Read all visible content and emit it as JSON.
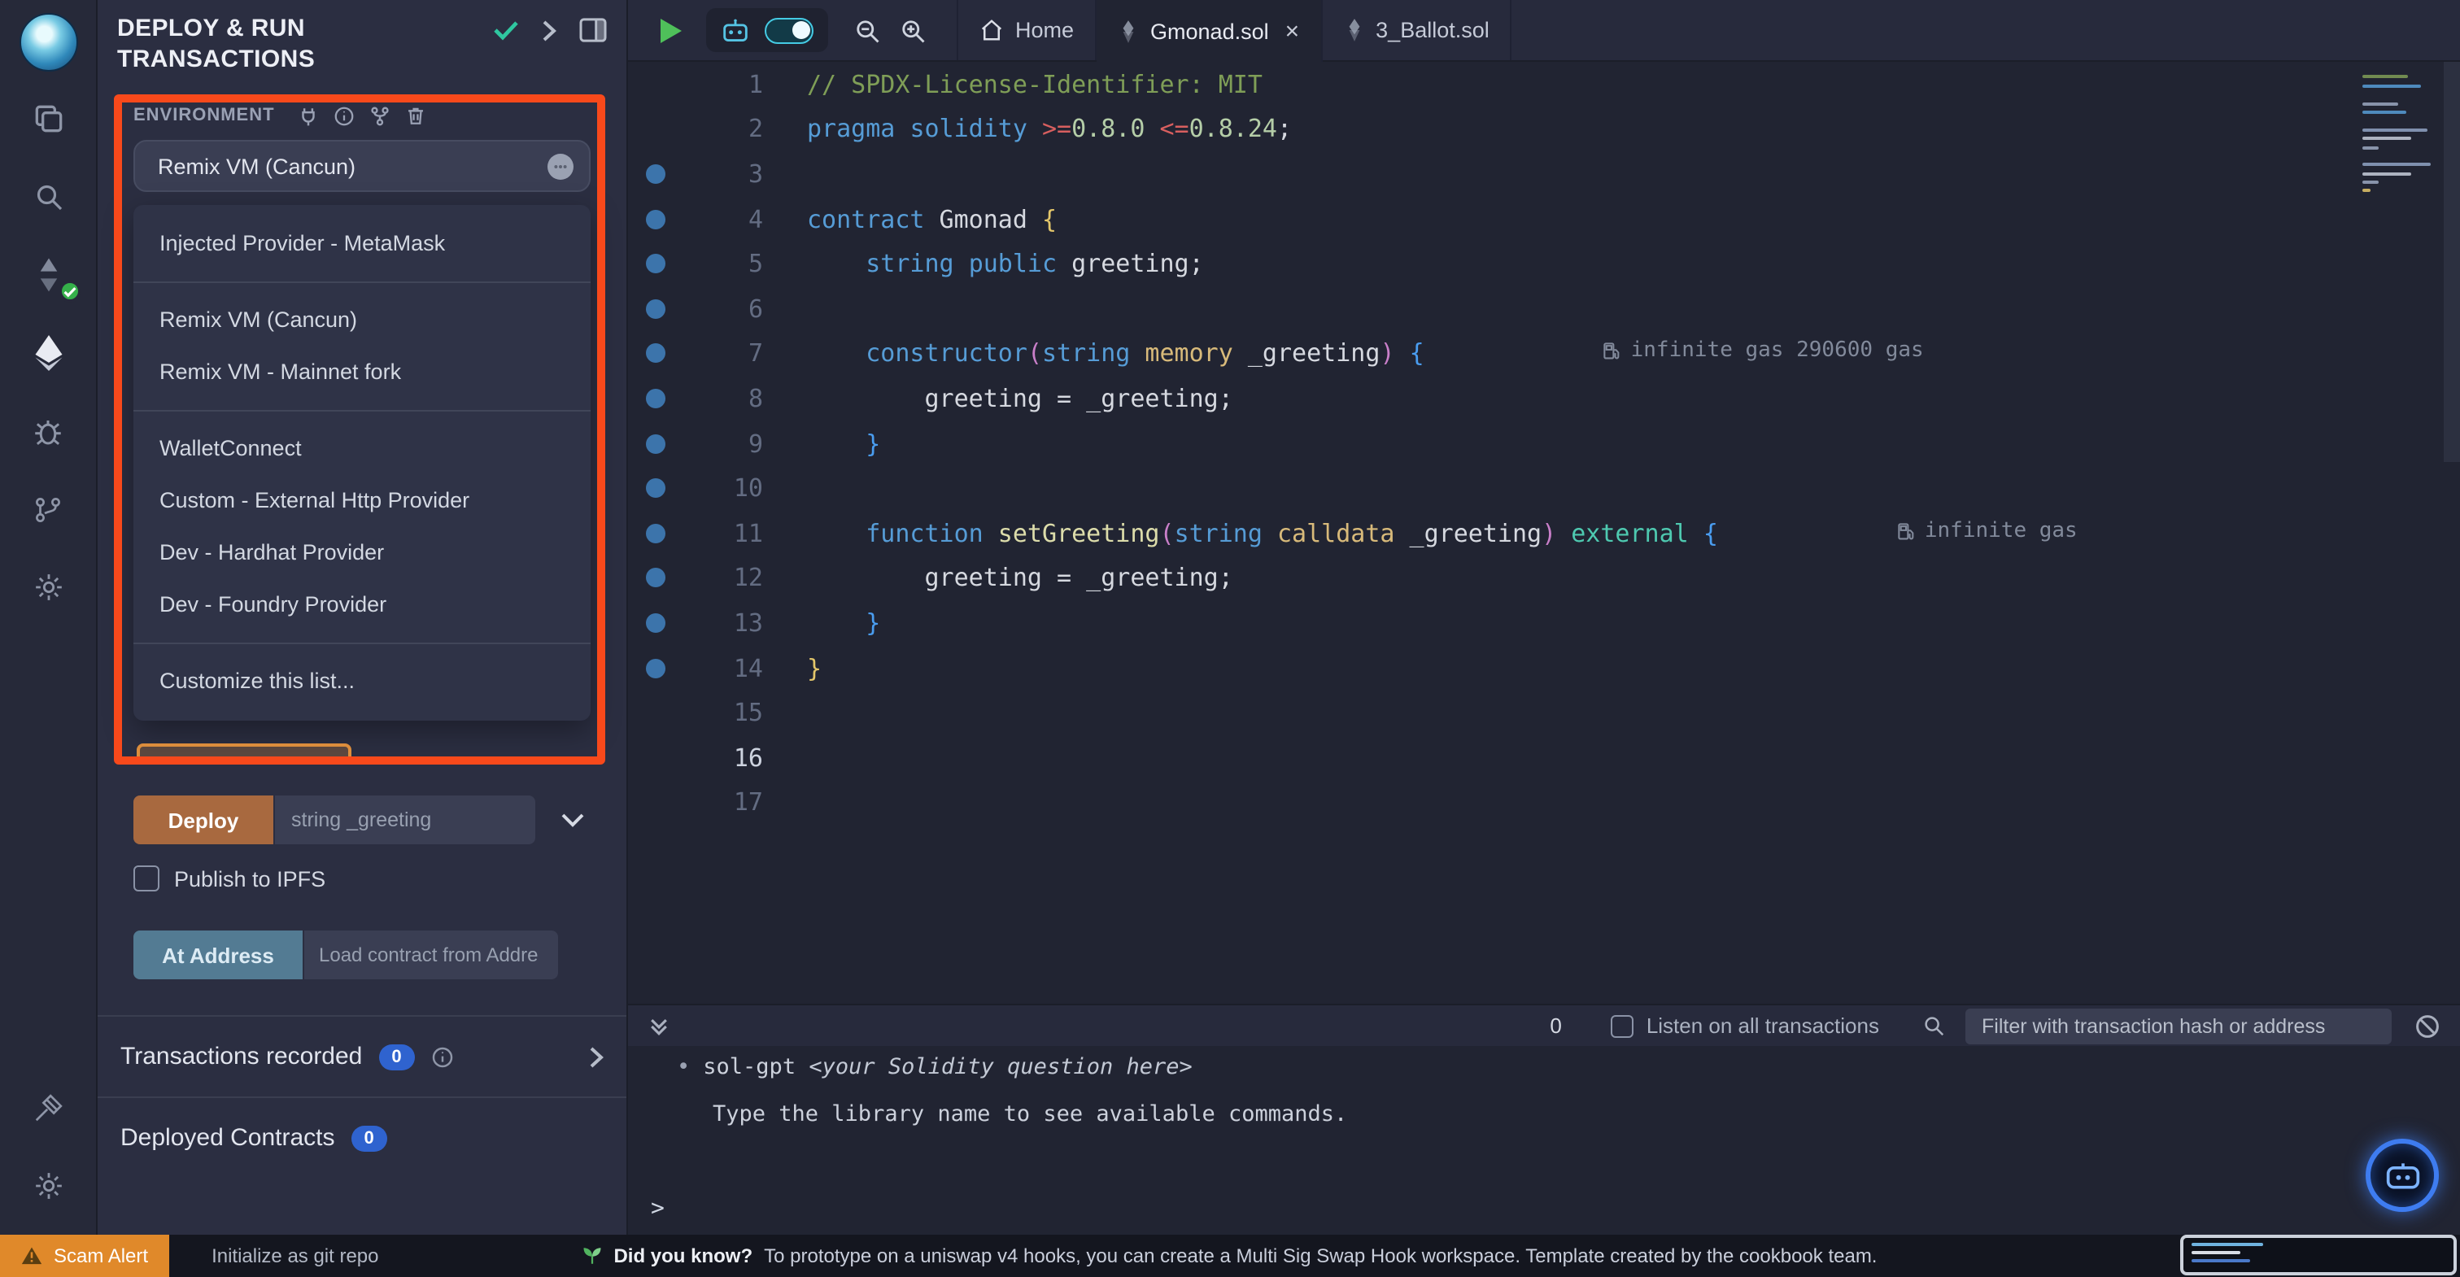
{
  "colors": {
    "highlight_box": "#f8491b",
    "deploy_button": "#a8693f",
    "at_address_button": "#537b93",
    "count_badge": "#2f63cf",
    "scam_alert_bg": "#e0892a",
    "toggle_accent": "#45cbe4",
    "run_button_green": "#4fc05a",
    "breakpoint_dot": "#3c74ab"
  },
  "rail": {
    "icons": [
      "remix-logo",
      "file-explorer",
      "search",
      "solidity-compiler",
      "deploy-and-run",
      "debugger",
      "git",
      "plugin-manager",
      "tools",
      "settings"
    ],
    "compiler_badge": "check"
  },
  "panel": {
    "title": "DEPLOY & RUN TRANSACTIONS",
    "environment": {
      "label": "ENVIRONMENT",
      "selected": "Remix VM (Cancun)",
      "options": [
        "Injected Provider - MetaMask",
        "Remix VM (Cancun)",
        "Remix VM - Mainnet fork",
        "WalletConnect",
        "Custom - External Http Provider",
        "Dev - Hardhat Provider",
        "Dev - Foundry Provider",
        "Customize this list..."
      ]
    },
    "deploy": {
      "button_label": "Deploy",
      "param_placeholder": "string _greeting",
      "publish_label": "Publish to IPFS",
      "at_address_label": "At Address",
      "at_address_placeholder": "Load contract from Addre"
    },
    "transactions": {
      "label": "Transactions recorded",
      "count": "0"
    },
    "deployed": {
      "label": "Deployed Contracts",
      "count": "0"
    }
  },
  "tabs": {
    "items": [
      {
        "label": "Home"
      },
      {
        "label": "Gmonad.sol"
      },
      {
        "label": "3_Ballot.sol"
      }
    ]
  },
  "editor": {
    "lines": [
      {
        "n": 1,
        "dot": false,
        "tokens": [
          [
            "com",
            "// SPDX-License-Identifier: MIT"
          ]
        ]
      },
      {
        "n": 2,
        "dot": false,
        "tokens": [
          [
            "kw",
            "pragma"
          ],
          [
            "pl",
            " "
          ],
          [
            "kw",
            "solidity"
          ],
          [
            "pl",
            " "
          ],
          [
            "op",
            ">="
          ],
          [
            "num",
            "0.8.0"
          ],
          [
            "pl",
            " "
          ],
          [
            "op",
            "<="
          ],
          [
            "num",
            "0.8.24"
          ],
          [
            "pl",
            ";"
          ]
        ]
      },
      {
        "n": 3,
        "dot": true,
        "tokens": []
      },
      {
        "n": 4,
        "dot": true,
        "tokens": [
          [
            "kw",
            "contract"
          ],
          [
            "pl",
            " Gmonad "
          ],
          [
            "b1",
            "{"
          ]
        ]
      },
      {
        "n": 5,
        "dot": true,
        "tokens": [
          [
            "pl",
            "    "
          ],
          [
            "kw",
            "string"
          ],
          [
            "pl",
            " "
          ],
          [
            "kw",
            "public"
          ],
          [
            "pl",
            " greeting;"
          ]
        ]
      },
      {
        "n": 6,
        "dot": true,
        "tokens": []
      },
      {
        "n": 7,
        "dot": true,
        "tokens": [
          [
            "pl",
            "    "
          ],
          [
            "kw",
            "constructor"
          ],
          [
            "b2",
            "("
          ],
          [
            "kw",
            "string"
          ],
          [
            "st",
            " memory"
          ],
          [
            "pl",
            " _greeting"
          ],
          [
            "b2",
            ")"
          ],
          [
            "pl",
            " "
          ],
          [
            "b3",
            "{"
          ]
        ],
        "gas": "infinite gas 290600 gas"
      },
      {
        "n": 8,
        "dot": true,
        "tokens": [
          [
            "pl",
            "        greeting = _greeting;"
          ]
        ]
      },
      {
        "n": 9,
        "dot": true,
        "tokens": [
          [
            "pl",
            "    "
          ],
          [
            "b3",
            "}"
          ]
        ]
      },
      {
        "n": 10,
        "dot": true,
        "tokens": []
      },
      {
        "n": 11,
        "dot": true,
        "tokens": [
          [
            "pl",
            "    "
          ],
          [
            "kw",
            "function"
          ],
          [
            "fn",
            " setGreeting"
          ],
          [
            "b2",
            "("
          ],
          [
            "kw",
            "string"
          ],
          [
            "st",
            " calldata"
          ],
          [
            "pl",
            " _greeting"
          ],
          [
            "b2",
            ")"
          ],
          [
            "ext",
            " external"
          ],
          [
            "pl",
            " "
          ],
          [
            "b3",
            "{"
          ]
        ],
        "gas": "infinite gas"
      },
      {
        "n": 12,
        "dot": true,
        "tokens": [
          [
            "pl",
            "        greeting = _greeting;"
          ]
        ]
      },
      {
        "n": 13,
        "dot": true,
        "tokens": [
          [
            "pl",
            "    "
          ],
          [
            "b3",
            "}"
          ]
        ]
      },
      {
        "n": 14,
        "dot": true,
        "tokens": [
          [
            "b1",
            "}"
          ]
        ]
      },
      {
        "n": 15,
        "dot": false,
        "tokens": []
      },
      {
        "n": 16,
        "dot": false,
        "active": true,
        "tokens": []
      },
      {
        "n": 17,
        "dot": false,
        "tokens": []
      }
    ]
  },
  "terminal": {
    "tx_count": "0",
    "listen_label": "Listen on all transactions",
    "filter_placeholder": "Filter with transaction hash or address",
    "bullet": "•",
    "cmd": "sol-gpt ",
    "cmd_hint": "<your Solidity question here>",
    "hint2": "Type the library name to see available commands.",
    "prompt": ">"
  },
  "statusbar": {
    "scam_alert": "Scam Alert",
    "git_init": "Initialize as git repo",
    "tip_bold": "Did you know?",
    "tip_text": "To prototype on a uniswap v4 hooks, you can create a Multi Sig Swap Hook workspace. Template created by the cookbook team."
  }
}
